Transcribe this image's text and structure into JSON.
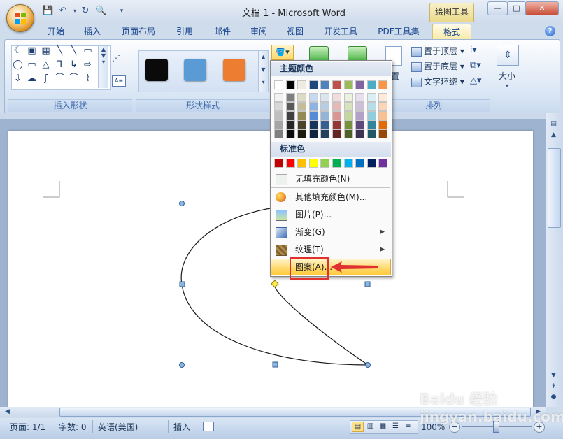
{
  "window": {
    "title": "文档 1 - Microsoft Word",
    "context_tab": "绘图工具",
    "buttons": {
      "minimize": "—",
      "restore": "□",
      "close": "✕"
    }
  },
  "tabs": [
    "开始",
    "插入",
    "页面布局",
    "引用",
    "邮件",
    "审阅",
    "视图",
    "开发工具",
    "PDF工具集",
    "格式"
  ],
  "ribbon": {
    "insert_shapes_label": "插入形状",
    "shape_styles_label": "形状样式",
    "arrange_label": "排列",
    "size_label": "大小",
    "shape_glyphs": [
      "☾",
      "▣",
      "▦",
      "╲",
      "╲",
      "▭",
      "◯",
      "▭",
      "△",
      "⅂",
      "↳",
      "⇨",
      "⇩",
      "☁",
      "ʃ",
      "⌒",
      "⌒",
      "⌇"
    ],
    "arrange_items": [
      "置于顶层",
      "置于底层",
      "文字环绕"
    ],
    "partial_label": "置",
    "style_colors": [
      "#0a0a0a",
      "#5b9bd5",
      "#ed7d31"
    ]
  },
  "dropdown": {
    "theme_colors_title": "主题颜色",
    "standard_colors_title": "标准色",
    "theme_top_row": [
      "#ffffff",
      "#000000",
      "#eeece1",
      "#1f497d",
      "#4f81bd",
      "#c0504d",
      "#9bbb59",
      "#8064a2",
      "#4bacc6",
      "#f79646"
    ],
    "theme_columns": [
      [
        "#f2f2f2",
        "#d8d8d8",
        "#bfbfbf",
        "#a5a5a5",
        "#7f7f7f"
      ],
      [
        "#7f7f7f",
        "#595959",
        "#3f3f3f",
        "#262626",
        "#0c0c0c"
      ],
      [
        "#ddd9c3",
        "#c4bd97",
        "#948a54",
        "#4a452a",
        "#1d1b10"
      ],
      [
        "#c6d9f0",
        "#8db3e2",
        "#548dd4",
        "#17365d",
        "#0f243e"
      ],
      [
        "#dbe5f1",
        "#b8cce4",
        "#95b3d7",
        "#366092",
        "#244061"
      ],
      [
        "#f2dcdb",
        "#e5b9b7",
        "#d99694",
        "#953734",
        "#632423"
      ],
      [
        "#ebf1dd",
        "#d7e3bc",
        "#c3d69b",
        "#76923c",
        "#4f6128"
      ],
      [
        "#e5e0ec",
        "#ccc1d9",
        "#b2a2c7",
        "#5f497a",
        "#3f3151"
      ],
      [
        "#dbeef3",
        "#b7dde8",
        "#92cddc",
        "#31859b",
        "#205867"
      ],
      [
        "#fdeada",
        "#fbd5b5",
        "#fac08f",
        "#e36c09",
        "#974806"
      ]
    ],
    "standard_colors": [
      "#c00000",
      "#ff0000",
      "#ffc000",
      "#ffff00",
      "#92d050",
      "#00b050",
      "#00b0f0",
      "#0070c0",
      "#002060",
      "#7030a0"
    ],
    "items": {
      "no_fill": "无填充颜色(N)",
      "more_colors": "其他填充颜色(M)...",
      "picture": "图片(P)...",
      "gradient": "渐变(G)",
      "texture": "纹理(T)",
      "pattern": "图案(A)..."
    }
  },
  "statusbar": {
    "page": "页面: 1/1",
    "words": "字数: 0",
    "language": "英语(美国)",
    "mode": "插入",
    "zoom": "100%"
  },
  "watermark": "Baidu 经验  jingyan.baidu.com"
}
